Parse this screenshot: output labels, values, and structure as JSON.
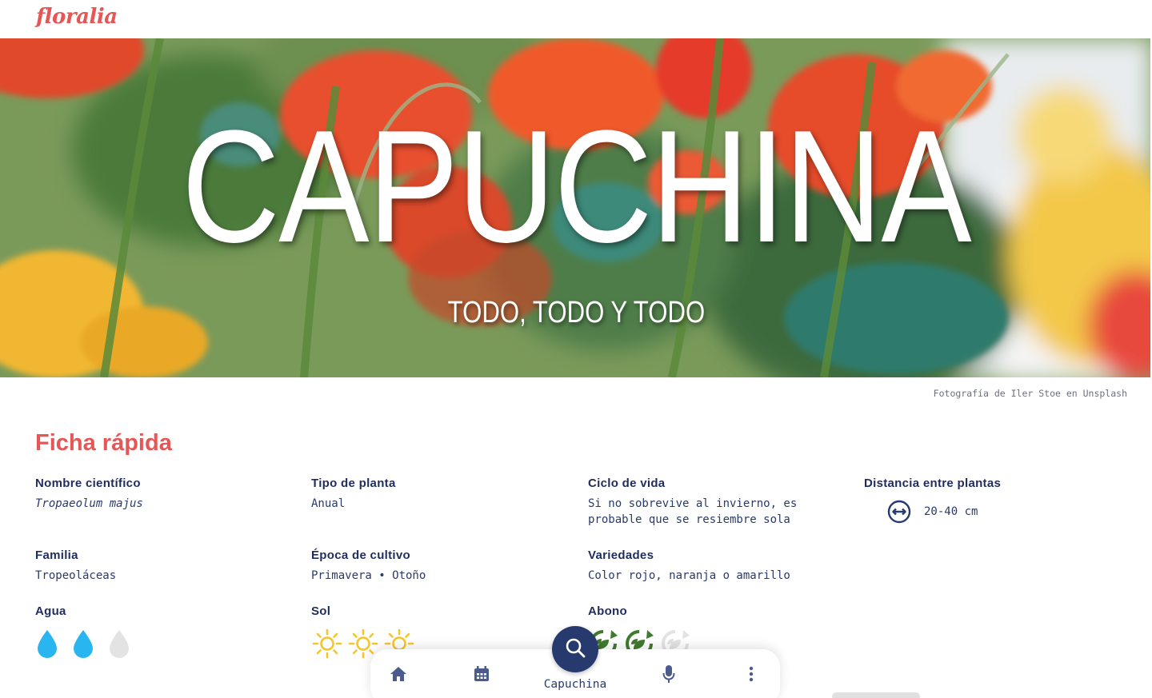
{
  "app": {
    "logo": "floralia"
  },
  "hero": {
    "title": "CAPUCHINA",
    "subtitle": "TODO, TODO Y TODO",
    "credit": "Fotografía de Iler Stoe en Unsplash"
  },
  "quick_sheet": {
    "title": "Ficha rápida",
    "scientific_name": {
      "label": "Nombre científico",
      "value": "Tropaeolum majus"
    },
    "plant_type": {
      "label": "Tipo de planta",
      "value": "Anual"
    },
    "life_cycle": {
      "label": "Ciclo de vida",
      "value": "Si no sobrevive al invierno, es probable que se resiembre sola"
    },
    "spacing": {
      "label": "Distancia entre plantas",
      "value": "20-40 cm",
      "icon": "distance-arrows-icon"
    },
    "family": {
      "label": "Familia",
      "value": "Tropeoláceas"
    },
    "season": {
      "label": "Época de cultivo",
      "value": "Primavera • Otoño"
    },
    "varieties": {
      "label": "Variedades",
      "value": "Color rojo, naranja o amarillo"
    },
    "water": {
      "label": "Agua",
      "level": 2,
      "max": 3,
      "icon": "water-drop-icon",
      "active_color": "#29b6f0",
      "inactive_color": "#e3e3e3"
    },
    "sun": {
      "label": "Sol",
      "level": 3,
      "max": 3,
      "icon": "sun-icon",
      "active_color": "#f4c62a"
    },
    "fertilizer": {
      "label": "Abono",
      "level": 2,
      "max": 3,
      "icon": "compost-icon",
      "active_color": "#3f7a2e",
      "inactive_color": "#e3e3e3"
    }
  },
  "bottom_nav": {
    "items": [
      {
        "name": "home",
        "icon": "home-icon"
      },
      {
        "name": "calendar",
        "icon": "calendar-icon"
      },
      {
        "name": "search",
        "icon": "search-icon",
        "label": "Capuchina"
      },
      {
        "name": "voice",
        "icon": "microphone-icon"
      },
      {
        "name": "more",
        "icon": "more-vertical-icon"
      }
    ]
  },
  "colors": {
    "accent": "#e55757",
    "navy": "#1f2d5c",
    "fab": "#273a6e"
  }
}
